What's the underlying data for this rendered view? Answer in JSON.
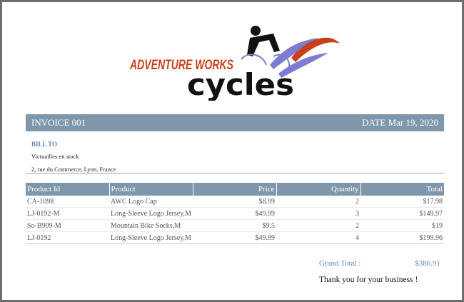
{
  "logo": {
    "line1": "ADVENTURE WORKS",
    "line2": "cycles",
    "colors": {
      "accent": "#c8401a",
      "swoosh": "#7e7bd2",
      "ink": "#111111"
    }
  },
  "header": {
    "invoice": "INVOICE 001",
    "date": "DATE Mar 19, 2020",
    "bg_color": "#7f97ab"
  },
  "bill_to": {
    "label": "BILL TO",
    "name": "Victuailles en stock",
    "address": "2, rue du Commerce, Lyon, France"
  },
  "table": {
    "columns": [
      "Product Id",
      "Product",
      "Price",
      "Quantity",
      "Total"
    ],
    "rows": [
      [
        "CA-1098",
        "AWC Logo Cap",
        "$8.99",
        "2",
        "$17.98"
      ],
      [
        "LJ-0192-M",
        "Long-Sleeve Logo Jersey,M",
        "$49.99",
        "3",
        "$149.97"
      ],
      [
        "So-B909-M",
        "Mountain Bike Socks,M",
        "$9.5",
        "2",
        "$19"
      ],
      [
        "LJ-0192",
        "Long-Sleeve Logo Jersey,M",
        "$49.99",
        "4",
        "$199.96"
      ]
    ]
  },
  "summary": {
    "grand_total_label": "Grand Total :",
    "grand_total_value": "$386.91",
    "thanks": "Thank you for your business !"
  }
}
